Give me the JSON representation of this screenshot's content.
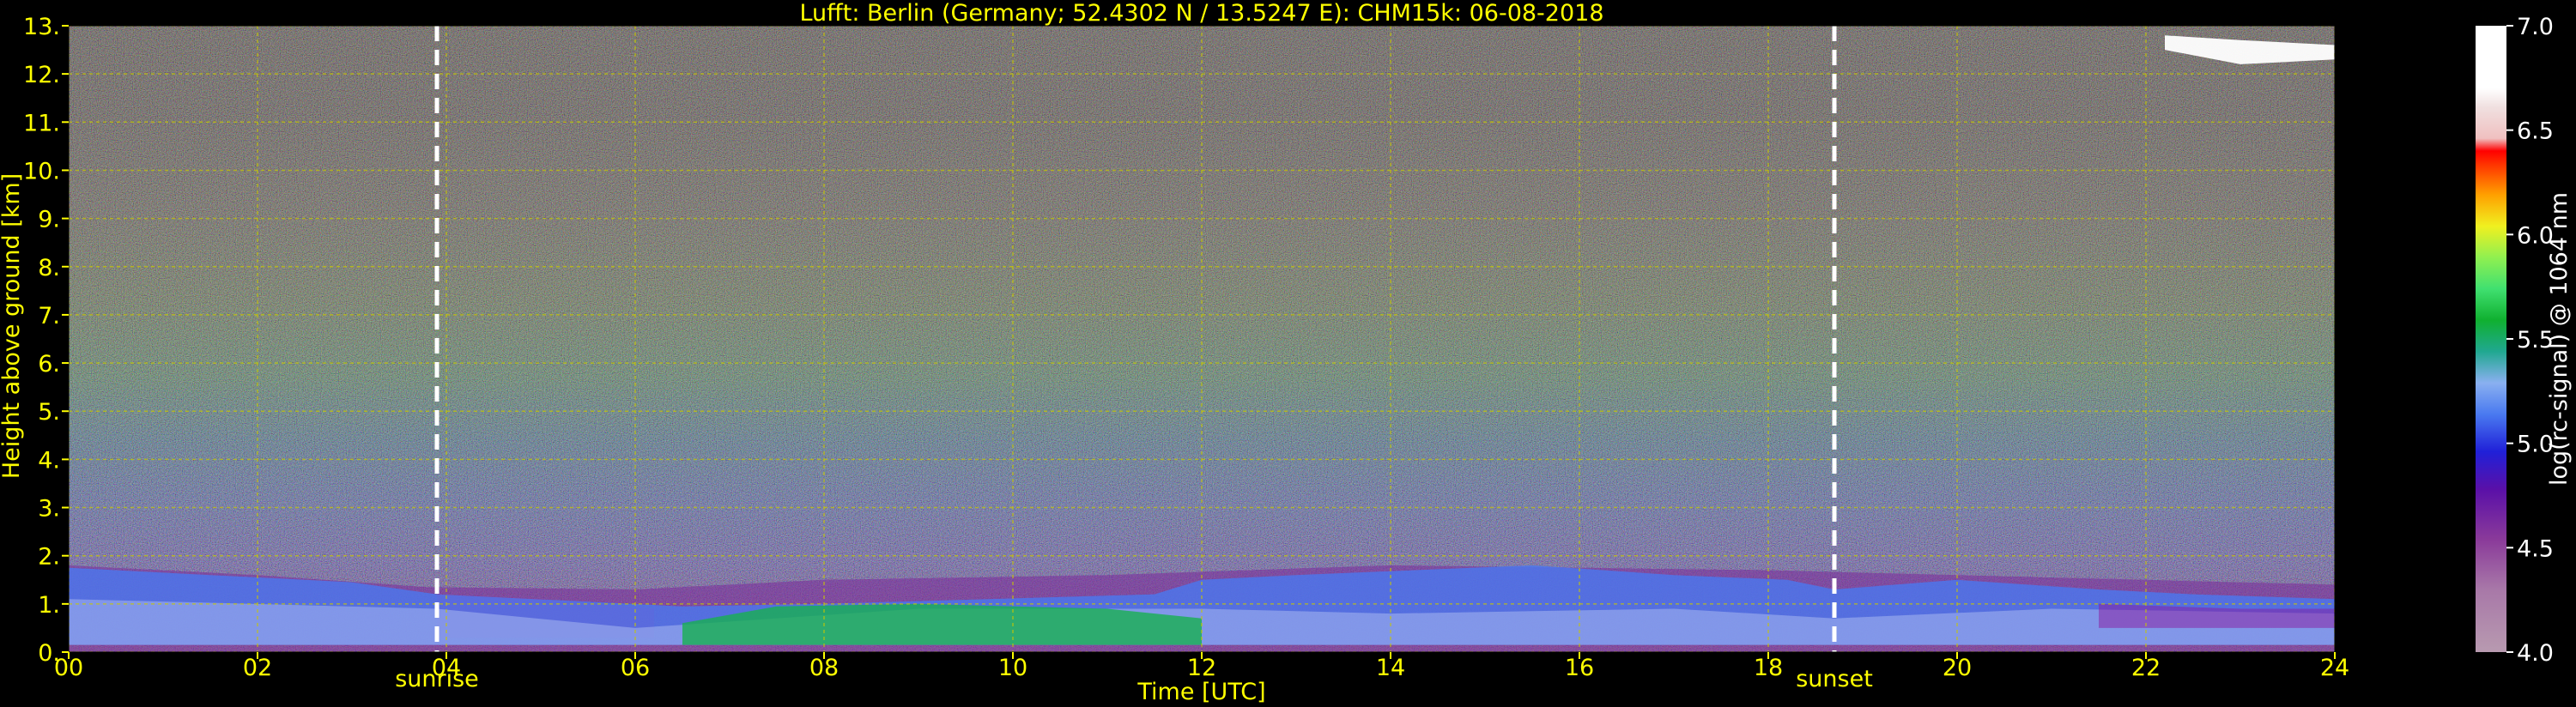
{
  "chart_data": {
    "type": "heatmap",
    "title": "Lufft: Berlin (Germany; 52.4302 N / 13.5247 E):    CHM15k: 06-08-2018",
    "xlabel": "Time [UTC]",
    "ylabel": "Height above ground [km]",
    "xlim": [
      0,
      24
    ],
    "ylim": [
      0,
      13
    ],
    "x_ticks": [
      "00",
      "02",
      "04",
      "06",
      "08",
      "10",
      "12",
      "14",
      "16",
      "18",
      "20",
      "22",
      "24"
    ],
    "y_ticks": [
      "0.",
      "1.",
      "2.",
      "3.",
      "4.",
      "5.",
      "6.",
      "7.",
      "8.",
      "9.",
      "10.",
      "11.",
      "12.",
      "13."
    ],
    "grid": true,
    "colorbar": {
      "label": "log(rc-signal) @ 1064 nm",
      "range": [
        4.0,
        7.0
      ],
      "ticks": [
        "4.0",
        "4.5",
        "5.0",
        "5.5",
        "6.0",
        "6.5",
        "7.0"
      ]
    },
    "annotations": [
      {
        "label": "sunrise",
        "x": 3.9
      },
      {
        "label": "sunset",
        "x": 18.7
      }
    ],
    "colors": {
      "text": "#ffff00",
      "grid": "#c8c800",
      "marker_line": "#ffffff"
    }
  }
}
